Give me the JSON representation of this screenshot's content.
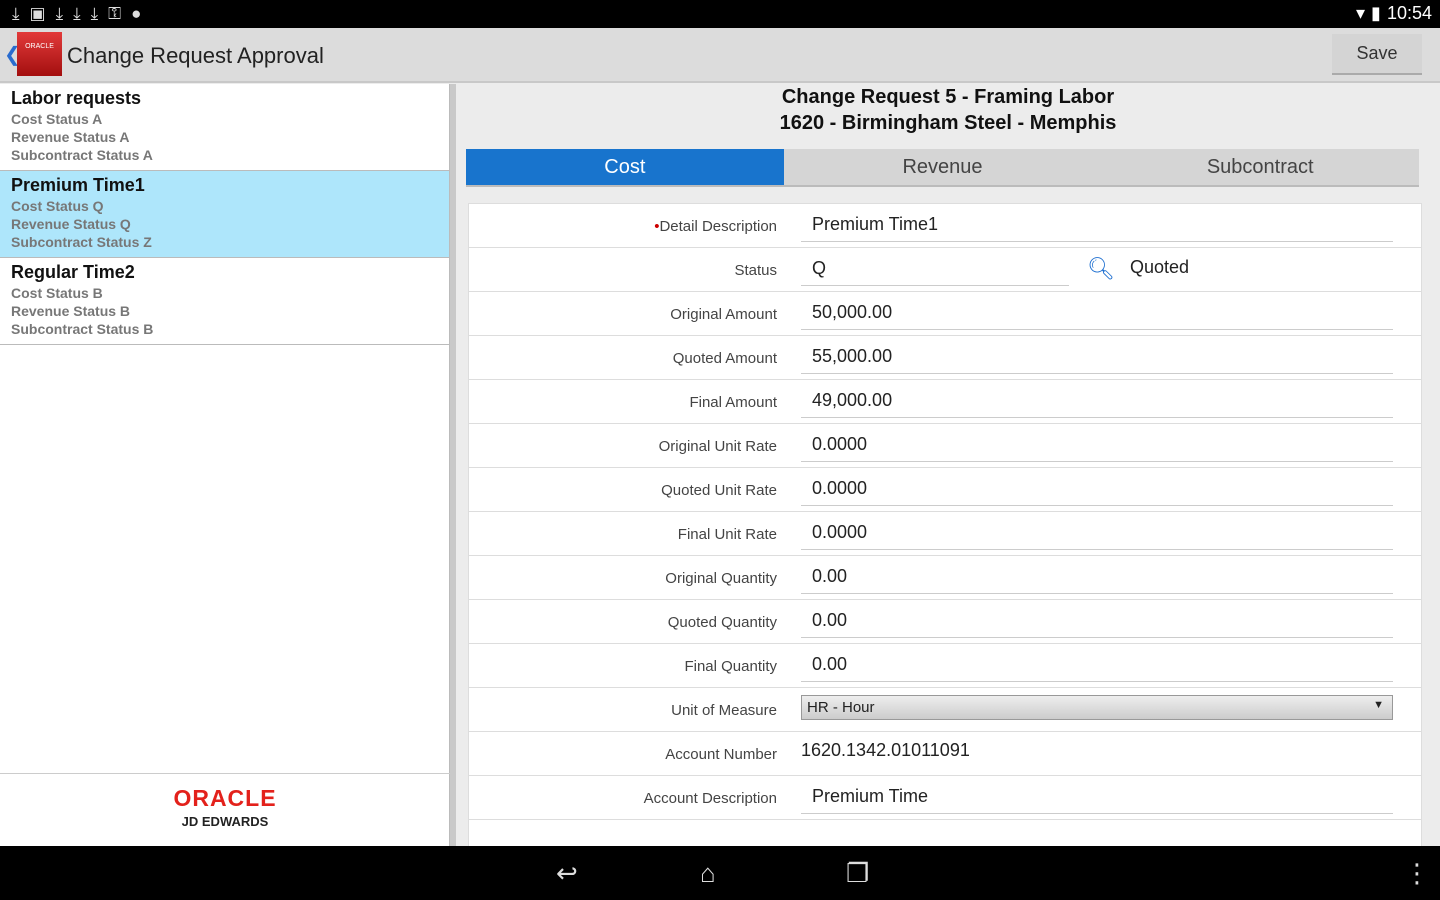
{
  "statusbar": {
    "time": "10:54"
  },
  "app": {
    "title": "Change Request Approval",
    "save_label": "Save",
    "logo_text": "ORACLE"
  },
  "list": [
    {
      "title": "Labor requests",
      "lines": [
        "Cost Status A",
        "Revenue Status A",
        "Subcontract Status A"
      ],
      "selected": false
    },
    {
      "title": "Premium Time1",
      "lines": [
        "Cost Status Q",
        "Revenue Status Q",
        "Subcontract Status Z"
      ],
      "selected": true
    },
    {
      "title": "Regular Time2",
      "lines": [
        "Cost Status B",
        "Revenue Status B",
        "Subcontract Status B"
      ],
      "selected": false
    }
  ],
  "branding": {
    "oracle": "ORACLE",
    "product": "JD EDWARDS"
  },
  "detail": {
    "line1": "Change Request 5 - Framing Labor",
    "line2": "1620 - Birmingham Steel - Memphis"
  },
  "tabs": [
    {
      "label": "Cost",
      "active": true
    },
    {
      "label": "Revenue",
      "active": false
    },
    {
      "label": "Subcontract",
      "active": false
    }
  ],
  "form": {
    "detail_description": {
      "label": "Detail Description",
      "value": "Premium Time1",
      "required_mark": "•"
    },
    "status": {
      "label": "Status",
      "value": "Q",
      "description": "Quoted"
    },
    "original_amount": {
      "label": "Original Amount",
      "value": "50,000.00"
    },
    "quoted_amount": {
      "label": "Quoted Amount",
      "value": "55,000.00"
    },
    "final_amount": {
      "label": "Final Amount",
      "value": "49,000.00"
    },
    "original_unit_rate": {
      "label": "Original Unit Rate",
      "value": "0.0000"
    },
    "quoted_unit_rate": {
      "label": "Quoted Unit Rate",
      "value": "0.0000"
    },
    "final_unit_rate": {
      "label": "Final Unit Rate",
      "value": "0.0000"
    },
    "original_quantity": {
      "label": "Original Quantity",
      "value": "0.00"
    },
    "quoted_quantity": {
      "label": "Quoted Quantity",
      "value": "0.00"
    },
    "final_quantity": {
      "label": "Final Quantity",
      "value": "0.00"
    },
    "unit_of_measure": {
      "label": "Unit of Measure",
      "value": "HR - Hour"
    },
    "account_number": {
      "label": "Account Number",
      "value": "1620.1342.01011091"
    },
    "account_description": {
      "label": "Account Description",
      "value": "Premium Time"
    }
  }
}
